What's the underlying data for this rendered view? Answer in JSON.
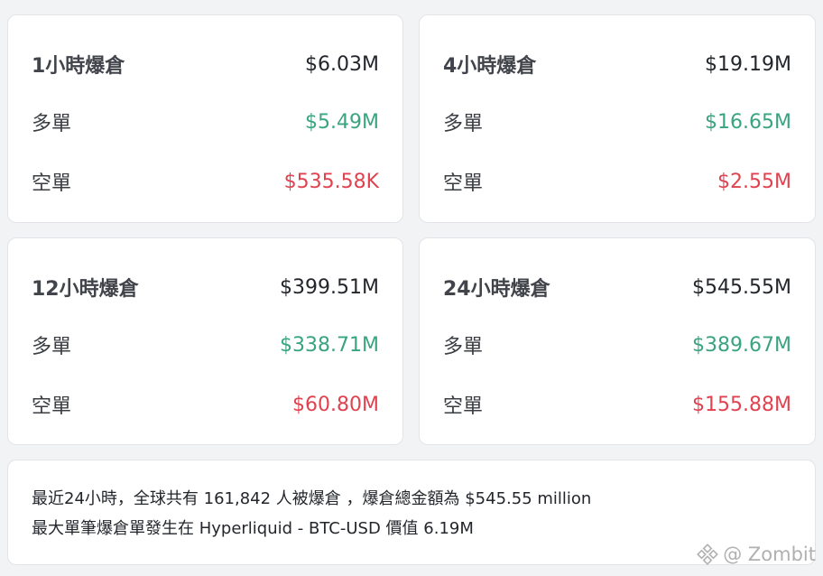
{
  "cards": [
    {
      "title": "1小時爆倉",
      "total": "$6.03M",
      "long_label": "多單",
      "long_value": "$5.49M",
      "short_label": "空單",
      "short_value": "$535.58K"
    },
    {
      "title": "4小時爆倉",
      "total": "$19.19M",
      "long_label": "多單",
      "long_value": "$16.65M",
      "short_label": "空單",
      "short_value": "$2.55M"
    },
    {
      "title": "12小時爆倉",
      "total": "$399.51M",
      "long_label": "多單",
      "long_value": "$338.71M",
      "short_label": "空單",
      "short_value": "$60.80M"
    },
    {
      "title": "24小時爆倉",
      "total": "$545.55M",
      "long_label": "多單",
      "long_value": "$389.67M",
      "short_label": "空單",
      "short_value": "$155.88M"
    }
  ],
  "summary": {
    "line1": "最近24小時，全球共有 161,842 人被爆倉 ，爆倉總金額為 $545.55 million",
    "line2": "最大單筆爆倉單發生在 Hyperliquid - BTC-USD 價值 6.19M"
  },
  "watermark": {
    "icon": "binance-square-logo-icon",
    "text": "@ Zombit"
  },
  "colors": {
    "long": "#3aa47f",
    "short": "#e0424f",
    "text": "#23262b",
    "background": "#f2f3f5",
    "card": "#ffffff"
  }
}
